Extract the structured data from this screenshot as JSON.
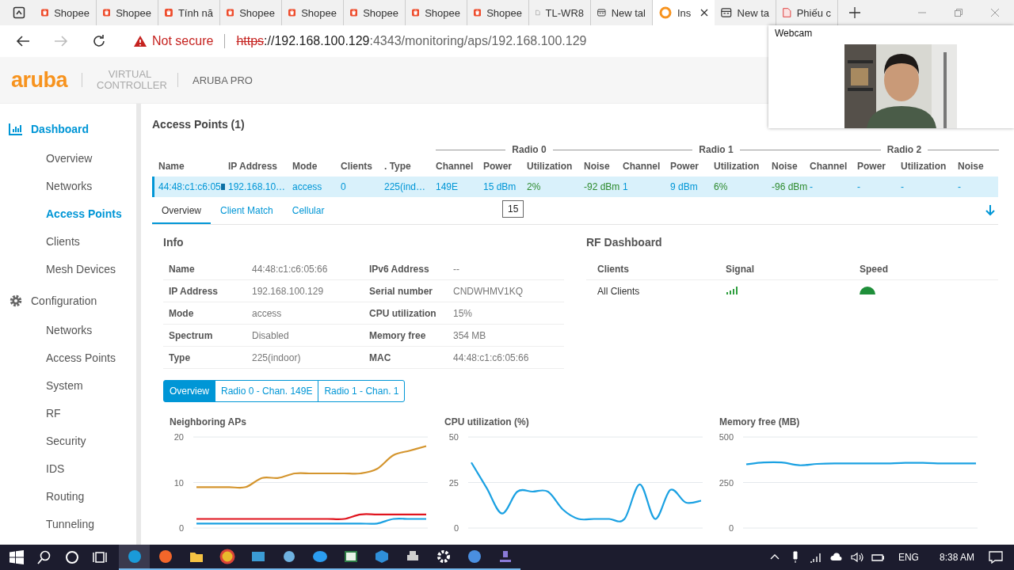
{
  "browser": {
    "tabs": [
      {
        "title": "Shopee",
        "kind": "shopee",
        "selected": false
      },
      {
        "title": "Shopee",
        "kind": "shopee",
        "selected": false
      },
      {
        "title": "Tính nă",
        "kind": "shopee",
        "selected": false
      },
      {
        "title": "Shopee",
        "kind": "shopee",
        "selected": false
      },
      {
        "title": "Shopee",
        "kind": "shopee",
        "selected": false
      },
      {
        "title": "Shopee",
        "kind": "shopee",
        "selected": false
      },
      {
        "title": "Shopee",
        "kind": "shopee",
        "selected": false
      },
      {
        "title": "Shopee",
        "kind": "shopee",
        "selected": false
      },
      {
        "title": "TL-WR8",
        "kind": "page",
        "selected": false
      },
      {
        "title": "New tal",
        "kind": "newtab",
        "selected": false
      },
      {
        "title": "Ins",
        "kind": "aruba",
        "selected": true
      },
      {
        "title": "New ta",
        "kind": "newtab",
        "selected": false
      },
      {
        "title": "Phiếu c",
        "kind": "pdf",
        "selected": false
      }
    ],
    "address": {
      "security": "Not secure",
      "scheme": "https",
      "host": "://192.168.100.129",
      "path": ":4343/monitoring/aps/192.168.100.129"
    }
  },
  "webcam": {
    "title": "Webcam"
  },
  "header": {
    "logo": "aruba",
    "product": "VIRTUAL CONTROLLER",
    "account": "ARUBA PRO"
  },
  "sidebar": {
    "sections": [
      {
        "title": "Dashboard",
        "selected": true,
        "items": [
          {
            "label": "Overview",
            "selected": false
          },
          {
            "label": "Networks",
            "selected": false
          },
          {
            "label": "Access Points",
            "selected": true
          },
          {
            "label": "Clients",
            "selected": false
          },
          {
            "label": "Mesh Devices",
            "selected": false
          }
        ]
      },
      {
        "title": "Configuration",
        "selected": false,
        "items": [
          {
            "label": "Networks",
            "selected": false
          },
          {
            "label": "Access Points",
            "selected": false
          },
          {
            "label": "System",
            "selected": false
          },
          {
            "label": "RF",
            "selected": false
          },
          {
            "label": "Security",
            "selected": false
          },
          {
            "label": "IDS",
            "selected": false
          },
          {
            "label": "Routing",
            "selected": false
          },
          {
            "label": "Tunneling",
            "selected": false
          }
        ]
      }
    ]
  },
  "access_points": {
    "title": "Access Points (1)",
    "groups": [
      "Radio 0",
      "Radio 1",
      "Radio 2"
    ],
    "columns": [
      {
        "label": "Name",
        "kind": "info"
      },
      {
        "label": "IP Address",
        "kind": "info"
      },
      {
        "label": "Mode",
        "kind": "info"
      },
      {
        "label": "Clients",
        "kind": "info"
      },
      {
        "label": ". Type",
        "kind": "info"
      },
      {
        "label": "Channel",
        "kind": "info"
      },
      {
        "label": "Power",
        "kind": "info"
      },
      {
        "label": "Utilization",
        "kind": "stat"
      },
      {
        "label": "Noise",
        "kind": "stat"
      },
      {
        "label": "Channel",
        "kind": "info"
      },
      {
        "label": "Power",
        "kind": "info"
      },
      {
        "label": "Utilization",
        "kind": "stat"
      },
      {
        "label": "Noise",
        "kind": "stat"
      },
      {
        "label": "Channel",
        "kind": "info"
      },
      {
        "label": "Power",
        "kind": "info"
      },
      {
        "label": "Utilization",
        "kind": "info"
      },
      {
        "label": "Noise",
        "kind": "info"
      }
    ],
    "rows": [
      {
        "selected": true,
        "cells": [
          "44:48:c1:c6:05",
          "192.168.10…",
          "access",
          "0",
          "225(ind…",
          "149E",
          "15 dBm",
          "2%",
          "-92 dBm",
          "1",
          "9 dBm",
          "6%",
          "-96 dBm",
          "-",
          "-",
          "-",
          "-"
        ]
      }
    ],
    "tooltip": "15"
  },
  "detail_tabs": [
    {
      "label": "Overview",
      "selected": true
    },
    {
      "label": "Client Match",
      "selected": false
    },
    {
      "label": "Cellular",
      "selected": false
    }
  ],
  "info": {
    "title": "Info",
    "left": [
      {
        "label": "Name",
        "value": "44:48:c1:c6:05:66"
      },
      {
        "label": "IP Address",
        "value": "192.168.100.129"
      },
      {
        "label": "Mode",
        "value": "access"
      },
      {
        "label": "Spectrum",
        "value": "Disabled"
      },
      {
        "label": "Type",
        "value": "225(indoor)"
      }
    ],
    "right": [
      {
        "label": "IPv6 Address",
        "value": "--"
      },
      {
        "label": "Serial number",
        "value": "CNDWHMV1KQ"
      },
      {
        "label": "CPU utilization",
        "value": "15%"
      },
      {
        "label": "Memory free",
        "value": "354 MB"
      },
      {
        "label": "MAC",
        "value": "44:48:c1:c6:05:66"
      }
    ]
  },
  "rf_dashboard": {
    "title": "RF Dashboard",
    "columns": [
      "Clients",
      "Signal",
      "Speed"
    ],
    "rows": [
      {
        "label": "All Clients"
      }
    ]
  },
  "views": [
    {
      "label": "Overview",
      "selected": true
    },
    {
      "label": "Radio 0 - Chan. 149E",
      "selected": false
    },
    {
      "label": "Radio 1 - Chan. 1",
      "selected": false
    }
  ],
  "charts": [
    {
      "title": "Neighboring APs",
      "chart_data": {
        "type": "line",
        "ylim": [
          0,
          20
        ],
        "yticks": [
          0,
          10,
          20
        ],
        "series": [
          {
            "color": "#d4952e",
            "values": [
              9,
              9,
              9,
              9,
              11,
              11,
              12,
              12,
              12,
              12,
              12,
              13,
              16,
              17,
              18
            ]
          },
          {
            "color": "#e0141e",
            "values": [
              2,
              2,
              2,
              2,
              2,
              2,
              2,
              2,
              2,
              2,
              3,
              3,
              3,
              3,
              3
            ]
          },
          {
            "color": "#1ba1e2",
            "values": [
              1,
              1,
              1,
              1,
              1,
              1,
              1,
              1,
              1,
              1,
              1,
              1,
              2,
              2,
              2
            ]
          }
        ]
      }
    },
    {
      "title": "CPU utilization (%)",
      "chart_data": {
        "type": "line",
        "ylim": [
          0,
          50
        ],
        "yticks": [
          0,
          25,
          50
        ],
        "series": [
          {
            "color": "#1ba1e2",
            "values": [
              36,
              22,
              8,
              20,
              20,
              20,
              10,
              5,
              5,
              5,
              5,
              24,
              5,
              21,
              14,
              15
            ]
          }
        ]
      }
    },
    {
      "title": "Memory free (MB)",
      "chart_data": {
        "type": "line",
        "ylim": [
          0,
          500
        ],
        "yticks": [
          0,
          250,
          500
        ],
        "series": [
          {
            "color": "#1ba1e2",
            "values": [
              350,
              360,
              360,
              345,
              352,
              355,
              355,
              355,
              355,
              358,
              358,
              355,
              355,
              355
            ]
          }
        ]
      }
    }
  ],
  "taskbar": {
    "language": "ENG",
    "time": "8:38 AM"
  }
}
